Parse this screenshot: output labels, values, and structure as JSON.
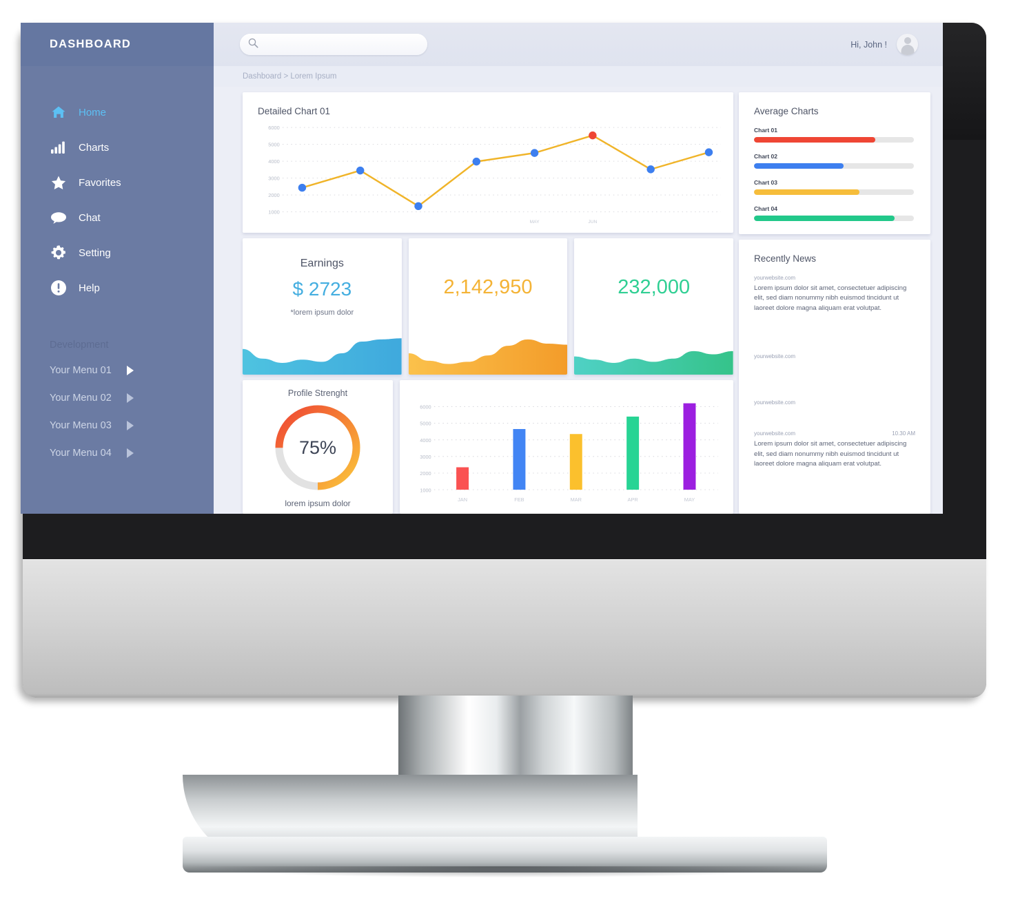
{
  "sidebar": {
    "title": "DASHBOARD",
    "items": [
      {
        "label": "Home",
        "icon": "home-icon",
        "active": true
      },
      {
        "label": "Charts",
        "icon": "bar-chart-icon",
        "active": false
      },
      {
        "label": "Favorites",
        "icon": "star-icon",
        "active": false
      },
      {
        "label": "Chat",
        "icon": "chat-bubble-icon",
        "active": false
      },
      {
        "label": "Setting",
        "icon": "gear-icon",
        "active": false
      },
      {
        "label": "Help",
        "icon": "exclamation-circle-icon",
        "active": false
      }
    ],
    "section_title": "Development",
    "submenu": [
      {
        "label": "Your Menu 01"
      },
      {
        "label": "Your Menu 02"
      },
      {
        "label": "Your Menu 03"
      },
      {
        "label": "Your Menu 04"
      }
    ]
  },
  "topbar": {
    "search_placeholder": "",
    "search_value": "",
    "search_icon": "search-icon",
    "greeting": "Hi, John !",
    "avatar_icon": "user-avatar-icon"
  },
  "breadcrumb": "Dashboard > Lorem Ipsum",
  "average_charts": {
    "title": "Average Charts",
    "bars": [
      {
        "label": "Chart 01",
        "percent": 76,
        "color": "#ef4634"
      },
      {
        "label": "Chart 02",
        "percent": 56,
        "color": "#3d7fef"
      },
      {
        "label": "Chart 03",
        "percent": 66,
        "color": "#f6bd3b"
      },
      {
        "label": "Chart 04",
        "percent": 88,
        "color": "#22c88a"
      }
    ]
  },
  "stat_cards": [
    {
      "title": "Earnings",
      "value": "$ 2723",
      "sub": "*lorem ipsum dolor",
      "color": "#44aee0"
    },
    {
      "title": "",
      "value": "2,142,950",
      "sub": "",
      "color": "#f4b335"
    },
    {
      "title": "",
      "value": "232,000",
      "sub": "",
      "color": "#2fcf93"
    }
  ],
  "profile_strength": {
    "title": "Profile Strenght",
    "value": "75%",
    "percent": 75,
    "sub": "lorem ipsum dolor"
  },
  "news": {
    "title": "Recently News",
    "items": [
      {
        "site": "yourwebsite.com",
        "time": "",
        "text": "Lorem ipsum dolor sit amet, consectetuer adipiscing elit, sed diam nonummy nibh euismod tincidunt ut laoreet dolore magna aliquam erat volutpat."
      },
      {
        "site": "yourwebsite.com",
        "time": "",
        "text": ""
      },
      {
        "site": "yourwebsite.com",
        "time": "",
        "text": ""
      },
      {
        "site": "yourwebsite.com",
        "time": "10.30 AM",
        "text": "Lorem ipsum dolor sit amet, consectetuer adipiscing elit, sed diam nonummy nibh euismod tincidunt ut laoreet dolore magna aliquam erat volutpat."
      }
    ]
  },
  "chart_data": [
    {
      "id": "detailed-chart-01",
      "type": "line",
      "title": "Detailed Chart 01",
      "xlabel": "",
      "ylabel": "",
      "ylim": [
        1000,
        6000
      ],
      "yticks": [
        6000,
        5000,
        4000,
        3000,
        2000,
        1000
      ],
      "grid": true,
      "x": [
        "",
        "",
        "",
        "",
        "",
        "MAY",
        "JUN",
        "",
        ""
      ],
      "tick_labels_visible": [
        "MAY",
        "JUN"
      ],
      "values": [
        2430,
        3450,
        1340,
        3980,
        4490,
        5530,
        3520,
        4530
      ],
      "line_color": "#f0b429",
      "point_color": "#3d7fef",
      "highlight_index": 5,
      "highlight_color": "#ef4634"
    },
    {
      "id": "monthly-bar-chart",
      "type": "bar",
      "title": "",
      "categories": [
        "JAN",
        "FEB",
        "MAR",
        "APR",
        "MAY"
      ],
      "values": [
        2350,
        4650,
        4350,
        5400,
        6200
      ],
      "colors": [
        "#fa5252",
        "#4285f4",
        "#fbc02d",
        "#27d494",
        "#9c1fe0"
      ],
      "ylim": [
        1000,
        6600
      ],
      "yticks": [
        6000,
        5000,
        4000,
        3000,
        2000,
        1000
      ],
      "grid": true,
      "xlabel": "",
      "ylabel": ""
    },
    {
      "id": "earnings-sparkline",
      "type": "area",
      "values": [
        48,
        30,
        22,
        28,
        24,
        40,
        62,
        66,
        68
      ],
      "color": "#3fa9dd"
    },
    {
      "id": "orange-sparkline",
      "type": "area",
      "values": [
        40,
        26,
        20,
        24,
        36,
        54,
        66,
        58,
        56
      ],
      "color": "#f39c2a"
    },
    {
      "id": "green-sparkline",
      "type": "area",
      "values": [
        34,
        28,
        22,
        30,
        24,
        30,
        44,
        38,
        44
      ],
      "color": "#35c38a"
    }
  ]
}
